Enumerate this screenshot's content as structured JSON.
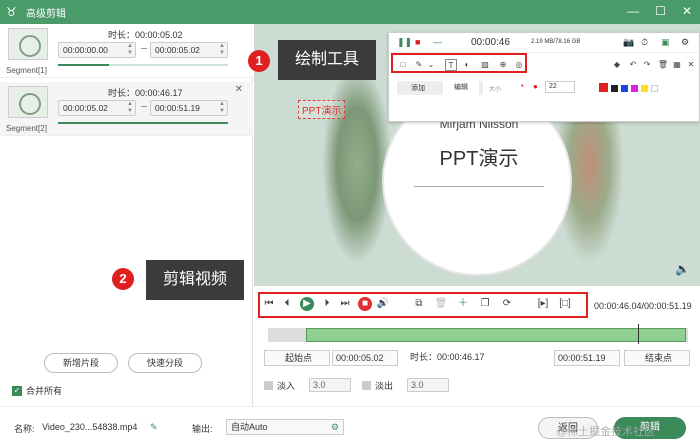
{
  "app": {
    "title": "高级剪辑"
  },
  "segments": [
    {
      "label": "Segment[1]",
      "duration_label": "时长：",
      "duration": "00:00:05.02",
      "start": "00:00:00.00",
      "end": "00:00:05.02"
    },
    {
      "label": "Segment[2]",
      "duration_label": "时长：",
      "duration": "00:00:46.17",
      "start": "00:00:05.02",
      "end": "00:00:51.19"
    }
  ],
  "left_buttons": {
    "add_segment": "新增片段",
    "quick_split": "快速分段"
  },
  "merge_all": "合并所有",
  "preview": {
    "text_label": "PPT演示",
    "slide_name": "Mirjam Nilsson",
    "slide_title": "PPT演示"
  },
  "recorder_toolbar": {
    "time": "00:00:46",
    "size": "2.19 MB/78.16 GB",
    "tab_add": "添加",
    "tab_edit": "编辑",
    "size_label": "大小",
    "size_value": "22"
  },
  "callouts": {
    "draw_num": "1",
    "draw_text": "绘制工具",
    "edit_num": "2",
    "edit_text": "剪辑视频"
  },
  "playback": {
    "position": "00:00:46.04/00:00:51.19"
  },
  "trim": {
    "start_label": "起始点",
    "start_value": "00:00:05.02",
    "duration_label": "时长：",
    "duration_value": "00:00:46.17",
    "end_value": "00:00:51.19",
    "end_label": "结束点"
  },
  "fade": {
    "in_label": "淡入",
    "in_value": "3.0",
    "out_label": "淡出",
    "out_value": "3.0"
  },
  "footer": {
    "name_label": "名称:",
    "name_value": "Video_230...54838.mp4",
    "output_label": "输出:",
    "output_value": "自动Auto",
    "back": "返回",
    "cut": "剪辑",
    "watermark": "@稀土掘金技术社区"
  },
  "colors": {
    "accent": "#3a8a5a",
    "titlebar": "#4a9a6a",
    "highlight": "#e02020"
  },
  "palette": [
    "#e02020",
    "#222222",
    "#2040e0",
    "#e020e0",
    "#ffe020",
    "#ffffff"
  ]
}
